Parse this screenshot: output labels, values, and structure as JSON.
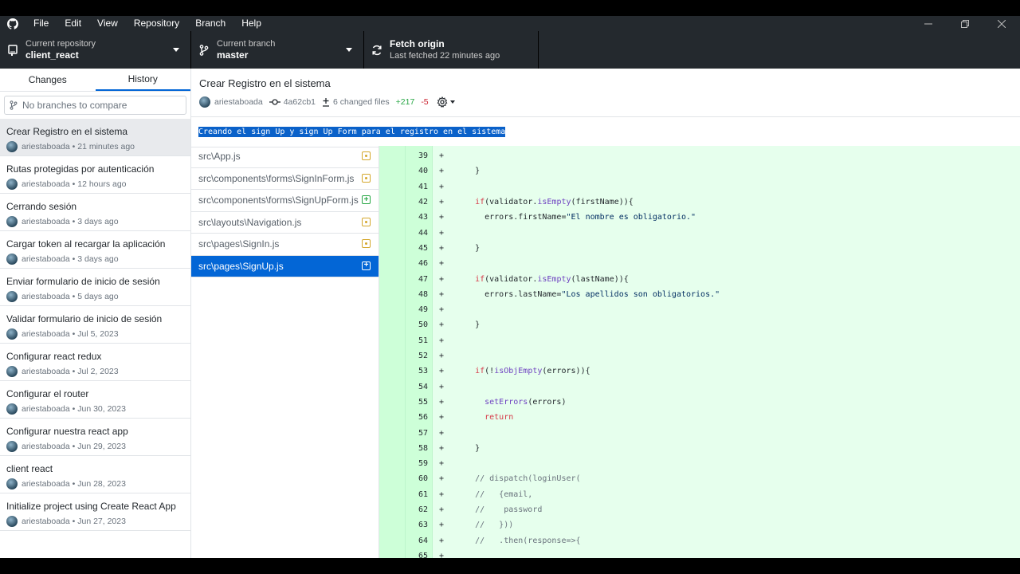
{
  "menu": [
    "File",
    "Edit",
    "View",
    "Repository",
    "Branch",
    "Help"
  ],
  "toolbar": {
    "repo_label": "Current repository",
    "repo_value": "client_react",
    "branch_label": "Current branch",
    "branch_value": "master",
    "fetch_label": "Fetch origin",
    "fetch_value": "Last fetched 22 minutes ago"
  },
  "sidebar": {
    "tab_changes": "Changes",
    "tab_history": "History",
    "compare_placeholder": "No branches to compare",
    "commits": [
      {
        "summary": "Crear Registro en el sistema",
        "meta": "ariestaboada • 21 minutes ago"
      },
      {
        "summary": "Rutas protegidas por autenticación",
        "meta": "ariestaboada • 12 hours ago"
      },
      {
        "summary": "Cerrando sesión",
        "meta": "ariestaboada • 3 days ago"
      },
      {
        "summary": "Cargar token al recargar la aplicación",
        "meta": "ariestaboada • 3 days ago"
      },
      {
        "summary": "Enviar formulario de inicio de sesión",
        "meta": "ariestaboada • 5 days ago"
      },
      {
        "summary": "Validar formulario de inicio de sesión",
        "meta": "ariestaboada • Jul 5, 2023"
      },
      {
        "summary": "Configurar react redux",
        "meta": "ariestaboada • Jul 2, 2023"
      },
      {
        "summary": "Configurar el router",
        "meta": "ariestaboada • Jun 30, 2023"
      },
      {
        "summary": "Configurar nuestra react app",
        "meta": "ariestaboada • Jun 29, 2023"
      },
      {
        "summary": "client react",
        "meta": "ariestaboada • Jun 28, 2023"
      },
      {
        "summary": "Initialize project using Create React App",
        "meta": "ariestaboada • Jun 27, 2023"
      }
    ]
  },
  "commit": {
    "title": "Crear Registro en el sistema",
    "author": "ariestaboada",
    "sha": "4a62cb1",
    "changed": "6 changed files",
    "additions": "+217",
    "deletions": "-5",
    "description": "Creando el sign Up y sign Up Form para el registro en el sistema"
  },
  "files": [
    {
      "path": "src\\App.js",
      "status": "modified"
    },
    {
      "path": "src\\components\\forms\\SignInForm.js",
      "status": "modified"
    },
    {
      "path": "src\\components\\forms\\SignUpForm.js",
      "status": "added"
    },
    {
      "path": "src\\layouts\\Navigation.js",
      "status": "modified"
    },
    {
      "path": "src\\pages\\SignIn.js",
      "status": "modified"
    },
    {
      "path": "src\\pages\\SignUp.js",
      "status": "added"
    }
  ],
  "diff_lines": [
    {
      "n": "39",
      "code": ""
    },
    {
      "n": "40",
      "code": "    }"
    },
    {
      "n": "41",
      "code": ""
    },
    {
      "n": "42",
      "code": "    if(validator.isEmpty(firstName)){"
    },
    {
      "n": "43",
      "code": "      errors.firstName=\"El nombre es obligatorio.\""
    },
    {
      "n": "44",
      "code": ""
    },
    {
      "n": "45",
      "code": "    }"
    },
    {
      "n": "46",
      "code": ""
    },
    {
      "n": "47",
      "code": "    if(validator.isEmpty(lastName)){"
    },
    {
      "n": "48",
      "code": "      errors.lastName=\"Los apellidos son obligatorios.\""
    },
    {
      "n": "49",
      "code": ""
    },
    {
      "n": "50",
      "code": "    }"
    },
    {
      "n": "51",
      "code": ""
    },
    {
      "n": "52",
      "code": ""
    },
    {
      "n": "53",
      "code": "    if(!isObjEmpty(errors)){"
    },
    {
      "n": "54",
      "code": ""
    },
    {
      "n": "55",
      "code": "      setErrors(errors)"
    },
    {
      "n": "56",
      "code": "      return"
    },
    {
      "n": "57",
      "code": ""
    },
    {
      "n": "58",
      "code": "    }"
    },
    {
      "n": "59",
      "code": ""
    },
    {
      "n": "60",
      "code": "    // dispatch(loginUser("
    },
    {
      "n": "61",
      "code": "    //   {email,"
    },
    {
      "n": "62",
      "code": "    //    password"
    },
    {
      "n": "63",
      "code": "    //   }))"
    },
    {
      "n": "64",
      "code": "    //   .then(response=>{"
    },
    {
      "n": "65",
      "code": ""
    }
  ]
}
